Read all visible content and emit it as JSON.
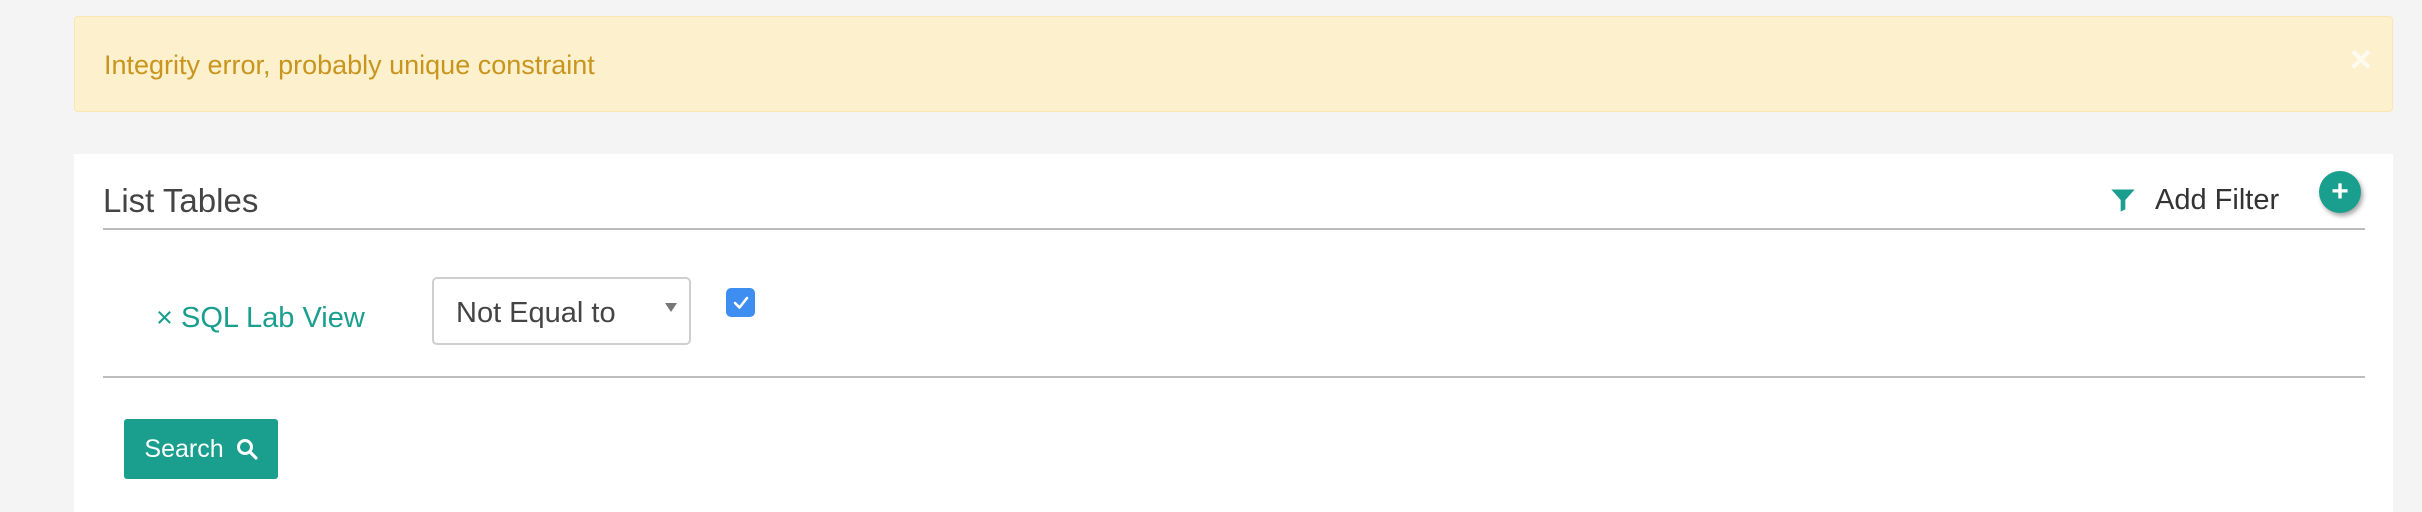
{
  "alert": {
    "message": "Integrity error, probably unique constraint",
    "close_glyph": "×",
    "bg_color": "#fdf0cc",
    "text_color": "#c8951e"
  },
  "panel": {
    "title": "List Tables",
    "add_filter_label": "Add Filter",
    "add_glyph": "+",
    "accent_color": "#1a9e8e"
  },
  "filter": {
    "remove_label": "× SQL Lab View",
    "operator_value": "Not Equal to",
    "checkbox_checked": true
  },
  "search": {
    "button_label": "Search"
  }
}
